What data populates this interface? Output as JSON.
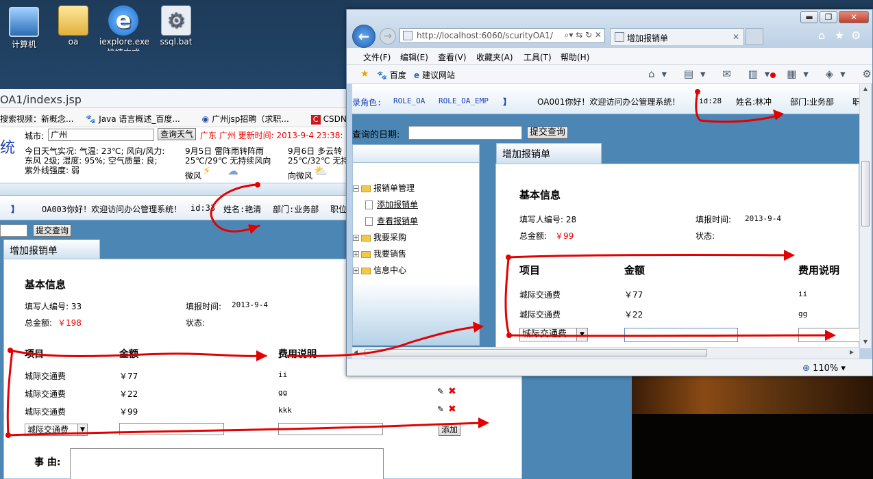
{
  "desktop": {
    "icons": [
      {
        "label": "计算机"
      },
      {
        "label": "oa"
      },
      {
        "label": "iexplore.exe",
        "sub": "快捷方式"
      },
      {
        "label": "ssql.bat"
      }
    ]
  },
  "bg_browser": {
    "address": "OA1/indexs.jsp",
    "favorites": [
      "搜索视频：新概念...",
      "Java 语言概述_百度...",
      "广州jsp招聘（求职...",
      "CSDN.NET"
    ],
    "weather": {
      "city_label": "城市:",
      "city_value": "广州",
      "query_button": "查询天气",
      "update_line": "广东 广州 更新时间: 2013-9-4 23:38:",
      "title_fragment": "统",
      "today": "今日天气实况: 气温: 23℃; 风向/风力: 东风 2级; 湿度: 95%; 空气质量: 良; 紫外线强度: 弱",
      "day1_title": "9月5日 雷阵雨转阵雨",
      "day1_temp": "25℃/29℃ 无持续风向",
      "day1_wind": "微风",
      "day2_title": "9月6日 多云转",
      "day2_temp": "25℃/32℃ 无持",
      "day2_wind": "向微风"
    },
    "userbar": {
      "bracket": "】",
      "greeting": "OA003你好！欢迎访问办公管理系统！",
      "id": "id:33",
      "name": "姓名:艳清",
      "dept": "部门:业务部",
      "pos": "职位"
    },
    "submit_button": "提交查询",
    "tab_title": "增加报销单",
    "section_title": "基本信息",
    "filler_no": "填写人编号: 33",
    "fill_time_label": "填报时间:",
    "fill_time_value": "2013-9-4",
    "total_label": "总金额:",
    "total_value": "￥198",
    "status_label": "状态:",
    "columns": [
      "项目",
      "金额",
      "费用说明"
    ],
    "rows": [
      {
        "item": "城际交通费",
        "amount": "￥77",
        "note": "ii"
      },
      {
        "item": "城际交通费",
        "amount": "￥22",
        "note": "gg"
      },
      {
        "item": "城际交通费",
        "amount": "￥99",
        "note": "kkk"
      }
    ],
    "select_value": "城际交通费",
    "add_button": "添加",
    "reason_label": "事 由:"
  },
  "ie": {
    "url": "http://localhost:6060/scurityOA1/",
    "tab_title": "增加报销单",
    "menu": [
      "文件(F)",
      "编辑(E)",
      "查看(V)",
      "收藏夹(A)",
      "工具(T)",
      "帮助(H)"
    ],
    "fav_items": [
      "百度",
      "建议网站"
    ],
    "userbar": {
      "roles_label": "录角色:",
      "role1": "ROLE_OA",
      "role2": "ROLE_OA_EMP",
      "bracket": "】",
      "greeting": "OA001你好！欢迎访问办公管理系统！",
      "id": "id:28",
      "name": "姓名:林冲",
      "dept": "部门:业务部",
      "more": "职"
    },
    "date_label": "查询的日期:",
    "submit_button": "提交查询",
    "tree": {
      "root": "报销单管理",
      "children": [
        "添加报销单",
        "查看报销单"
      ],
      "others": [
        "我要采购",
        "我要销售",
        "信息中心"
      ]
    },
    "section_title": "基本信息",
    "filler_no": "填写人编号: 28",
    "fill_time_label": "填报时间:",
    "fill_time_value": "2013-9-4",
    "total_label": "总金额:",
    "total_value": "￥99",
    "status_label": "状态:",
    "columns": [
      "项目",
      "金额",
      "费用说明"
    ],
    "rows": [
      {
        "item": "城际交通费",
        "amount": "￥77",
        "note": "ii"
      },
      {
        "item": "城际交通费",
        "amount": "￥22",
        "note": "gg"
      }
    ],
    "select_value": "城际交通费",
    "zoom": "110%"
  }
}
